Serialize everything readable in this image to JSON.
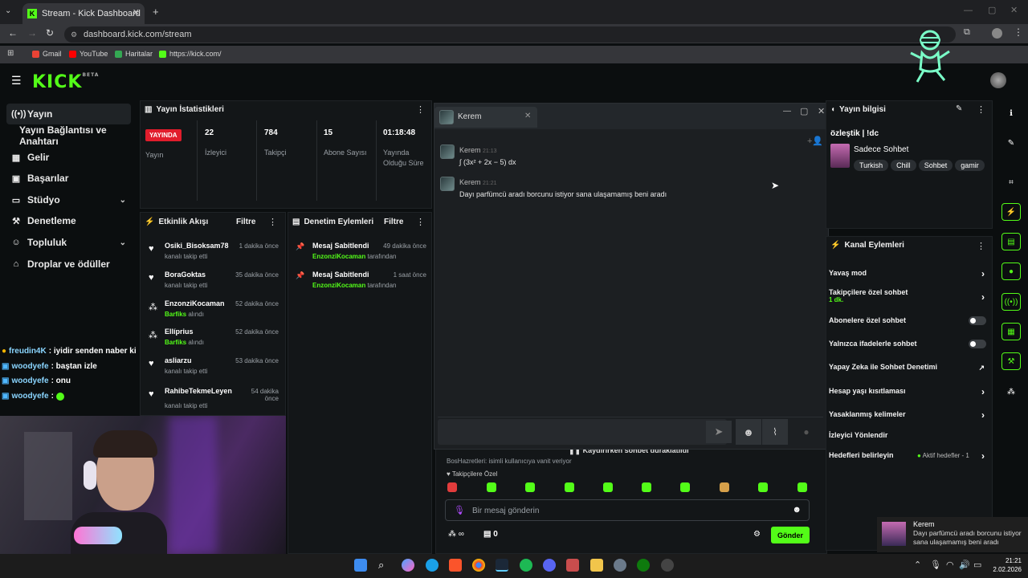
{
  "browser": {
    "tab_title": "Stream - Kick Dashboard",
    "url": "dashboard.kick.com/stream",
    "bookmarks": [
      {
        "label": "Gmail",
        "color": "#ea4335"
      },
      {
        "label": "YouTube",
        "color": "#ff0000"
      },
      {
        "label": "Haritalar",
        "color": "#34a853"
      },
      {
        "label": "https://kick.com/",
        "color": "#53fc18"
      }
    ]
  },
  "site": {
    "logo": "KICK",
    "beta": "BETA",
    "accent": "#53fc18"
  },
  "sidebar": {
    "items": [
      {
        "label": "Yayın",
        "icon": "broadcast-icon"
      },
      {
        "label": "Yayın Bağlantısı ve Anahtarı",
        "icon": ""
      },
      {
        "label": "Gelir",
        "icon": "revenue-icon"
      },
      {
        "label": "Başarılar",
        "icon": "achievements-icon"
      },
      {
        "label": "Stüdyo",
        "icon": "studio-icon"
      },
      {
        "label": "Denetleme",
        "icon": "moderation-icon"
      },
      {
        "label": "Topluluk",
        "icon": "community-icon"
      },
      {
        "label": "Droplar ve ödüller",
        "icon": "drops-icon"
      }
    ]
  },
  "stats": {
    "title": "Yayın İstatistikleri",
    "live_badge": "YAYINDA",
    "live_label": "Yayın",
    "viewers": "22",
    "viewers_label": "İzleyici",
    "followers": "784",
    "followers_label": "Takipçi",
    "subs": "15",
    "subs_label": "Abone Sayısı",
    "duration": "01:18:48",
    "duration_label": "Yayında Olduğu Süre"
  },
  "activity": {
    "title": "Etkinlik Akışı",
    "filter": "Filtre",
    "items": [
      {
        "name": "Osiki_Bisoksam78",
        "time": "1 dakika önce",
        "desc": "kanalı takip etti",
        "icon": "heart-icon"
      },
      {
        "name": "BoraGoktas",
        "time": "35 dakika önce",
        "desc": "kanalı takip etti",
        "icon": "heart-icon"
      },
      {
        "name": "EnzonziKocaman",
        "time": "52 dakika önce",
        "desc_green": "Barfiks",
        "desc": "alındı",
        "icon": "points-icon"
      },
      {
        "name": "Ellíprius",
        "time": "52 dakika önce",
        "desc_green": "Barfiks",
        "desc": "alındı",
        "icon": "points-icon"
      },
      {
        "name": "asliarzu",
        "time": "53 dakika önce",
        "desc": "kanalı takip etti",
        "icon": "heart-icon"
      },
      {
        "name": "RahibeTekmeLeyen",
        "time": "54 dakika önce",
        "desc": "kanalı takip etti",
        "icon": "heart-icon"
      }
    ]
  },
  "modlog": {
    "title": "Denetim Eylemleri",
    "filter": "Filtre",
    "items": [
      {
        "action": "Mesaj Sabitlendi",
        "time": "49 dakika önce",
        "by": "EnzonziKocaman",
        "suffix": "tarafından"
      },
      {
        "action": "Mesaj Sabitlendi",
        "time": "1 saat önce",
        "by": "EnzonziKocaman",
        "suffix": "tarafından"
      }
    ]
  },
  "chatwindow": {
    "tab_name": "Kerem",
    "messages": [
      {
        "user": "Kerem",
        "time": "21:13",
        "text": "∫ (3x² + 2x − 5) dx"
      },
      {
        "user": "Kerem",
        "time": "21:21",
        "text": "Dayı parfümcü aradı borcunu istiyor sana ulaşamamış beni aradı"
      }
    ]
  },
  "streamchat": {
    "paused": "Kaydırırken sohbet duraklatıldı",
    "prev_user": "BosHazretleri:",
    "prev_text": "isimli kullanıcıya vanit veriyor",
    "followers_only": "Takipçilere Özel",
    "placeholder": "Bir mesaj gönderin",
    "count": "0",
    "send": "Gönder"
  },
  "streaminfo": {
    "title": "Yayın bilgisi",
    "stream_title": "özleştik | !dc",
    "category": "Sadece Sohbet",
    "tags": [
      "Turkish",
      "Chill",
      "Sohbet",
      "gamir"
    ]
  },
  "channel_actions": {
    "title": "Kanal Eylemleri",
    "slow_mode": "Yavaş mod",
    "followers_chat": "Takipçilere özel sohbet",
    "followers_chat_sub": "1 dk.",
    "subs_chat": "Abonelere özel sohbet",
    "emote_chat": "Yalnızca ifadelerle sohbet",
    "ai_mod": "Yapay Zeka ile Sohbet Denetimi",
    "age_limit": "Hesap yaşı kısıtlaması",
    "banned_words": "Yasaklanmış kelimeler",
    "viewer_redirect": "İzleyici Yönlendir",
    "goals": "Hedefleri belirleyin",
    "goals_status": "Aktif hedefler - 1"
  },
  "overlay_chat": [
    {
      "user": "freudin4K",
      "text": ": iyidir senden naber ki"
    },
    {
      "user": "woodyefe",
      "text": ": baştan izle"
    },
    {
      "user": "woodyefe",
      "text": ": onu"
    },
    {
      "user": "woodyefe",
      "text": ":"
    }
  ],
  "notification": {
    "name": "Kerem",
    "text": "Dayı parfümcü aradı borcunu istiyor sana ulaşamamış beni aradı"
  },
  "clock": {
    "time": "21:21",
    "date": "2.02.2026"
  }
}
